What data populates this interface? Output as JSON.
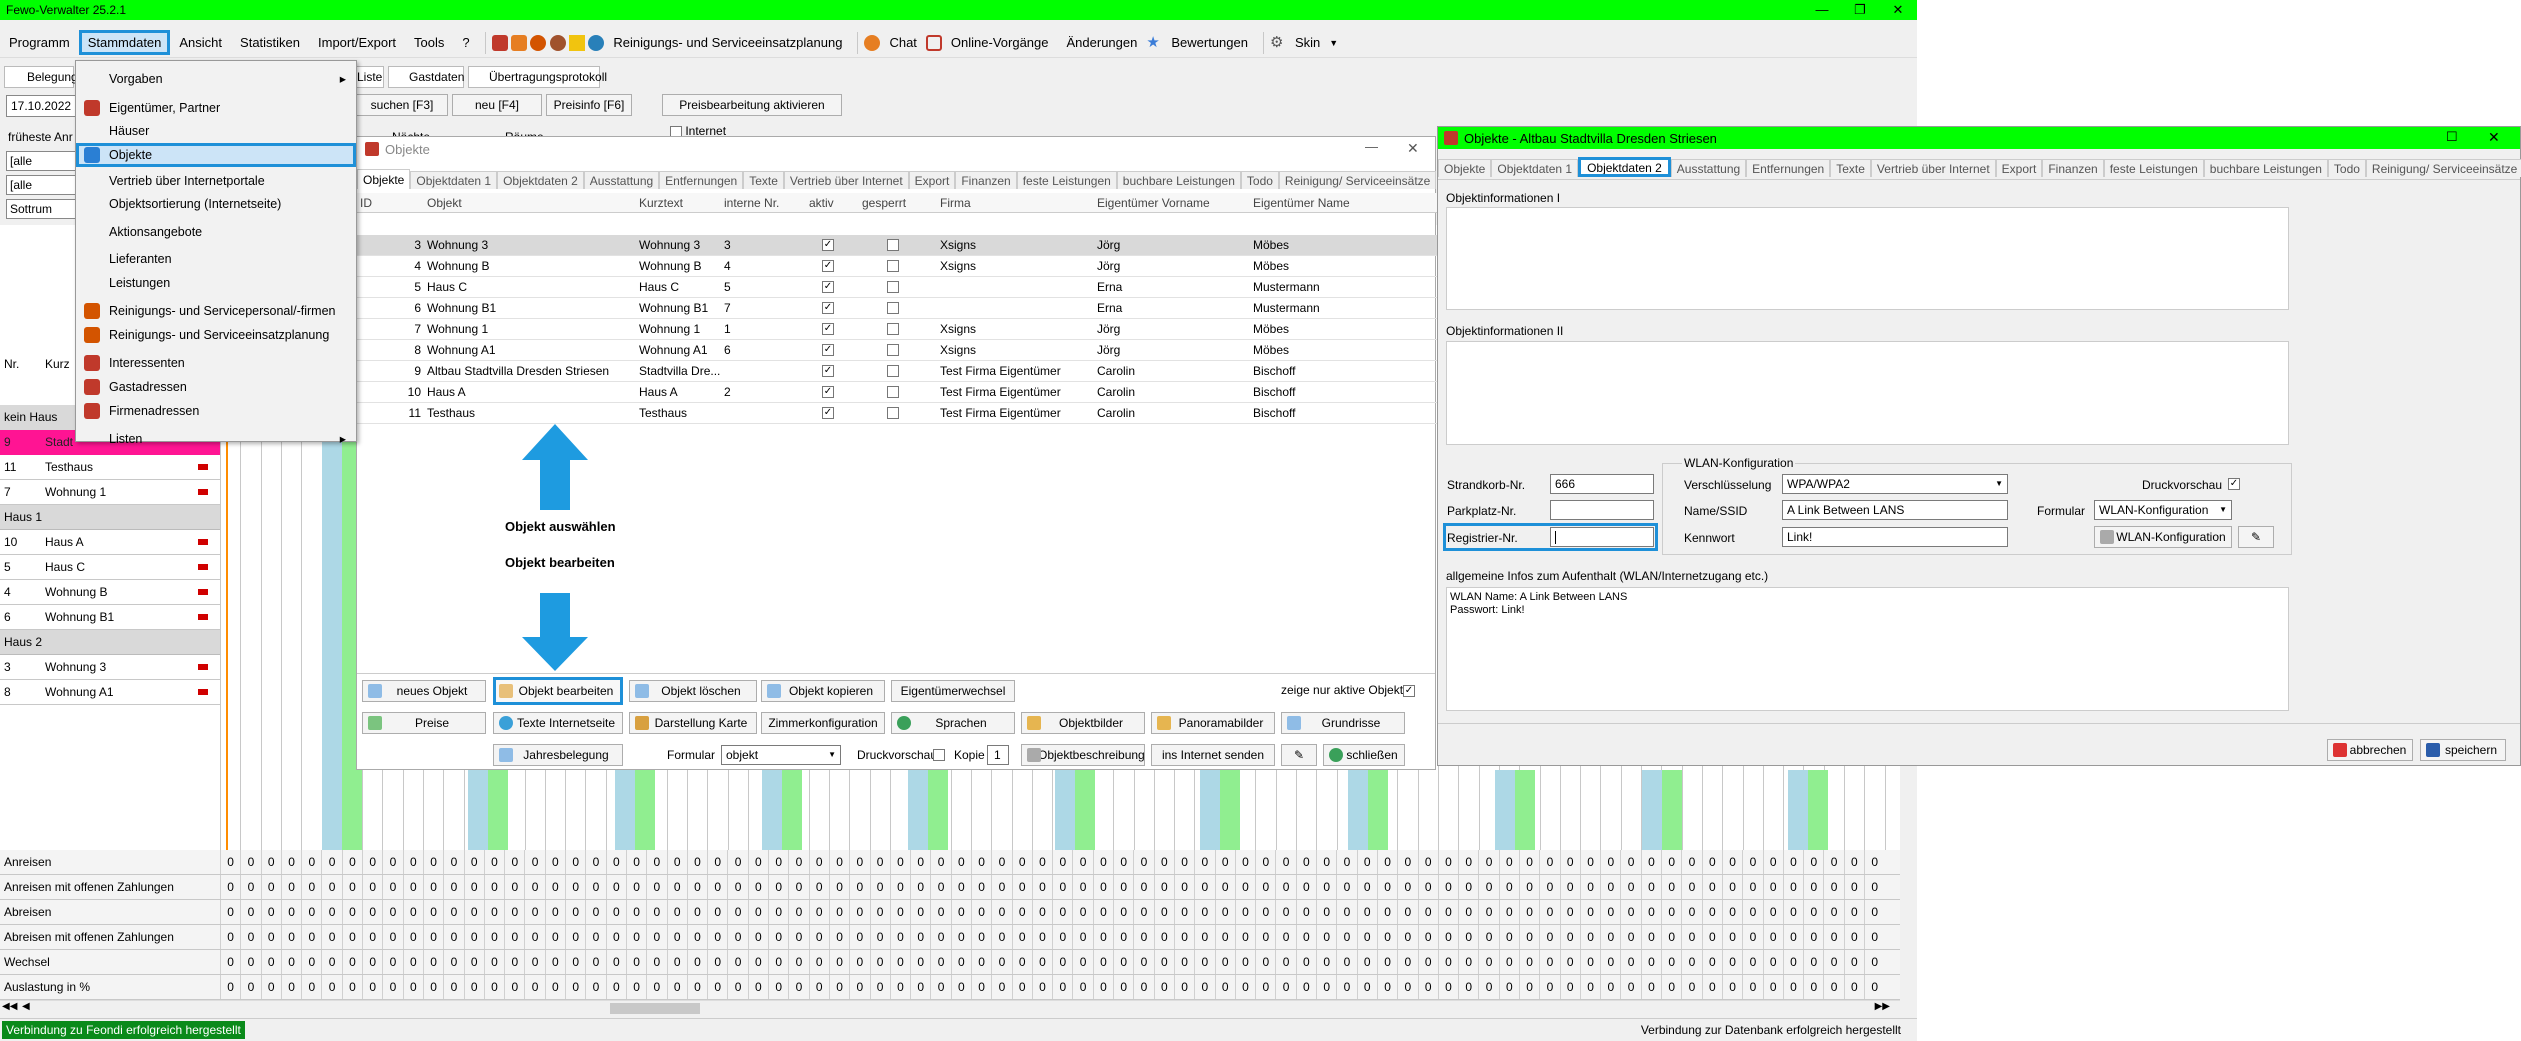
{
  "app": {
    "title": "Fewo-Verwalter 25.2.1"
  },
  "menu": [
    "Programm",
    "Stammdaten",
    "Ansicht",
    "Statistiken",
    "Import/Export",
    "Tools",
    "?"
  ],
  "toolbar": {
    "cleaning": "Reinigungs- und Serviceeinsatzplanung",
    "chat": "Chat",
    "online": "Online-Vorgänge",
    "changes": "Änderungen",
    "ratings": "Bewertungen",
    "skin": "Skin"
  },
  "dropdown": [
    "Vorgaben",
    "Eigentümer, Partner",
    "Häuser",
    "Objekte",
    "Vertrieb über Internetportale",
    "Objektsortierung (Internetseite)",
    "Aktionsangebote",
    "Lieferanten",
    "Leistungen",
    "Reinigungs- und Servicepersonal/-firmen",
    "Reinigungs- und Serviceeinsatzplanung",
    "Interessenten",
    "Gastadressen",
    "Firmenadressen",
    "Listen"
  ],
  "subtoolbar": {
    "belegung": "Belegung",
    "liste": "Liste",
    "gastdaten": "Gastdaten",
    "protokoll": "Übertragungsprotokoll",
    "date": "17.10.2022",
    "suchen": "suchen [F3]",
    "neu": "neu [F4]",
    "preisinfo": "Preisinfo [F6]",
    "preisbearbeitung": "Preisbearbeitung aktivieren",
    "frueheste": "früheste Anr",
    "alle_haeuser": "[alle Häuser]",
    "alle_objekte": "[alle Objekte]",
    "sottrum": "Sottrum Mitte",
    "internet": "Internet",
    "naechte": "Nächte",
    "raeume": "Räume"
  },
  "leftgrid": {
    "col_nr": "Nr.",
    "col_kurz": "Kurz",
    "kein_haus": "kein Haus",
    "top_row": "Stadt",
    "rows": [
      {
        "type": "row",
        "nr": "11",
        "name": "Testhaus"
      },
      {
        "type": "row",
        "nr": "7",
        "name": "Wohnung 1"
      },
      {
        "type": "group",
        "name": "Haus 1"
      },
      {
        "type": "row",
        "nr": "10",
        "name": "Haus A"
      },
      {
        "type": "row",
        "nr": "5",
        "name": "Haus C"
      },
      {
        "type": "row",
        "nr": "4",
        "name": "Wohnung B"
      },
      {
        "type": "row",
        "nr": "6",
        "name": "Wohnung B1"
      },
      {
        "type": "group",
        "name": "Haus 2"
      },
      {
        "type": "row",
        "nr": "3",
        "name": "Wohnung 3"
      },
      {
        "type": "row",
        "nr": "8",
        "name": "Wohnung A1"
      }
    ]
  },
  "stats": [
    "Anreisen",
    "Anreisen mit offenen Zahlungen",
    "Abreisen",
    "Abreisen mit offenen Zahlungen",
    "Wechsel",
    "Auslastung in %"
  ],
  "status": {
    "left": "Verbindung zu Feondi erfolgreich hergestellt",
    "right": "Verbindung zur Datenbank erfolgreich hergestellt"
  },
  "objwin": {
    "title": "Objekte",
    "tabs": [
      "Objekte",
      "Objektdaten 1",
      "Objektdaten 2",
      "Ausstattung",
      "Entfernungen",
      "Texte",
      "Vertrieb über Internet",
      "Export",
      "Finanzen",
      "feste Leistungen",
      "buchbare Leistungen",
      "Todo",
      "Reinigung/ Serviceeinsätze"
    ],
    "headers": [
      "ID",
      "Objekt",
      "Kurztext",
      "interne Nr.",
      "aktiv",
      "gesperrt",
      "Firma",
      "Eigentümer Vorname",
      "Eigentümer Name"
    ],
    "rows": [
      {
        "id": "3",
        "obj": "Wohnung 3",
        "kurz": "Wohnung 3",
        "nr": "3",
        "firma": "Xsigns",
        "vor": "Jörg",
        "name": "Möbes"
      },
      {
        "id": "4",
        "obj": "Wohnung B",
        "kurz": "Wohnung B",
        "nr": "4",
        "firma": "Xsigns",
        "vor": "Jörg",
        "name": "Möbes"
      },
      {
        "id": "5",
        "obj": "Haus C",
        "kurz": "Haus C",
        "nr": "5",
        "firma": "",
        "vor": "Erna",
        "name": "Mustermann"
      },
      {
        "id": "6",
        "obj": "Wohnung B1",
        "kurz": "Wohnung B1",
        "nr": "7",
        "firma": "",
        "vor": "Erna",
        "name": "Mustermann"
      },
      {
        "id": "7",
        "obj": "Wohnung 1",
        "kurz": "Wohnung 1",
        "nr": "1",
        "firma": "Xsigns",
        "vor": "Jörg",
        "name": "Möbes"
      },
      {
        "id": "8",
        "obj": "Wohnung A1",
        "kurz": "Wohnung A1",
        "nr": "6",
        "firma": "Xsigns",
        "vor": "Jörg",
        "name": "Möbes"
      },
      {
        "id": "9",
        "obj": "Altbau Stadtvilla Dresden Striesen",
        "kurz": "Stadtvilla Dre...",
        "nr": "",
        "firma": "Test Firma Eigentümer",
        "vor": "Carolin",
        "name": "Bischoff"
      },
      {
        "id": "10",
        "obj": "Haus A",
        "kurz": "Haus A",
        "nr": "2",
        "firma": "Test Firma Eigentümer",
        "vor": "Carolin",
        "name": "Bischoff"
      },
      {
        "id": "11",
        "obj": "Testhaus",
        "kurz": "Testhaus",
        "nr": "",
        "firma": "Test Firma Eigentümer",
        "vor": "Carolin",
        "name": "Bischoff"
      }
    ],
    "anno1": "Objekt auswählen",
    "anno2": "Objekt bearbeiten",
    "btns": {
      "neues": "neues Objekt",
      "bearbeiten": "Objekt bearbeiten",
      "loeschen": "Objekt löschen",
      "kopieren": "Objekt kopieren",
      "eigentuemer": "Eigentümerwechsel",
      "nur_aktive": "zeige nur aktive Objekte",
      "preise": "Preise",
      "texte": "Texte Internetseite",
      "karte": "Darstellung Karte",
      "zimmer": "Zimmerkonfiguration",
      "sprachen": "Sprachen",
      "bilder": "Objektbilder",
      "panorama": "Panoramabilder",
      "grundrisse": "Grundrisse",
      "jahres": "Jahresbelegung",
      "formular": "Formular",
      "formular_val": "objekt",
      "druck": "Druckvorschau",
      "kopie": "Kopie",
      "kopie_val": "1",
      "beschreibung": "Objektbeschreibung",
      "internet": "ins Internet senden",
      "schliessen": "schließen"
    }
  },
  "rwin": {
    "title": "Objekte - Altbau Stadtvilla Dresden Striesen",
    "tabs": [
      "Objekte",
      "Objektdaten 1",
      "Objektdaten 2",
      "Ausstattung",
      "Entfernungen",
      "Texte",
      "Vertrieb über Internet",
      "Export",
      "Finanzen",
      "feste Leistungen",
      "buchbare Leistungen",
      "Todo",
      "Reinigung/ Serviceeinsätze"
    ],
    "info1": "Objektinformationen I",
    "info2": "Objektinformationen II",
    "strandkorb": "Strandkorb-Nr.",
    "strandkorb_val": "666",
    "parkplatz": "Parkplatz-Nr.",
    "registrier": "Registrier-Nr.",
    "wlan_title": "WLAN-Konfiguration",
    "verschl": "Verschlüsselung",
    "verschl_val": "WPA/WPA2",
    "ssid": "Name/SSID",
    "ssid_val": "A Link Between LANS",
    "kennwort": "Kennwort",
    "kennwort_val": "Link!",
    "druck": "Druckvorschau",
    "formular": "Formular",
    "formular_val": "WLAN-Konfiguration",
    "wlan_btn": "WLAN-Konfiguration",
    "allg": "allgemeine Infos zum Aufenthalt (WLAN/Internetzugang etc.)",
    "allg_l1": "WLAN Name: A Link Between LANS",
    "allg_l2": "Passwort: Link!",
    "abbrechen": "abbrechen",
    "speichern": "speichern"
  },
  "colors": {
    "titlebar": "#00ff00",
    "highlight": "#1e90d8",
    "arrow": "#1e9be0"
  }
}
